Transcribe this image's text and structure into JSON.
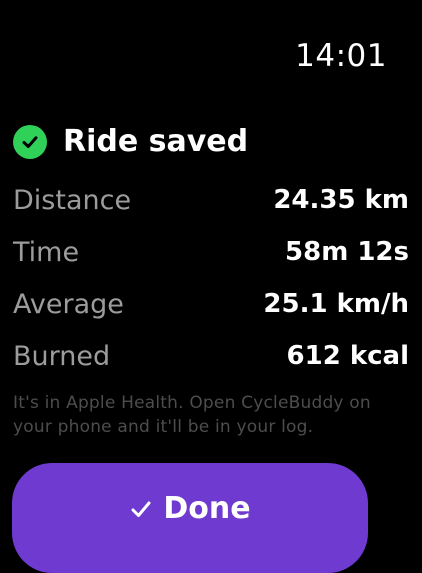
{
  "status_bar": {
    "time": "14:01"
  },
  "header": {
    "icon": "checkmark-circle-icon",
    "title": "Ride saved",
    "icon_color": "#30d158"
  },
  "stats": [
    {
      "label": "Distance",
      "value": "24.35 km"
    },
    {
      "label": "Time",
      "value": "58m 12s"
    },
    {
      "label": "Average",
      "value": "25.1 km/h"
    },
    {
      "label": "Burned",
      "value": "612 kcal"
    }
  ],
  "note": "It's in Apple Health. Open CycleBuddy on your phone and it'll be in your log.",
  "done_button": {
    "label": "Done",
    "icon": "checkmark-icon",
    "color": "#6e3ad0"
  }
}
